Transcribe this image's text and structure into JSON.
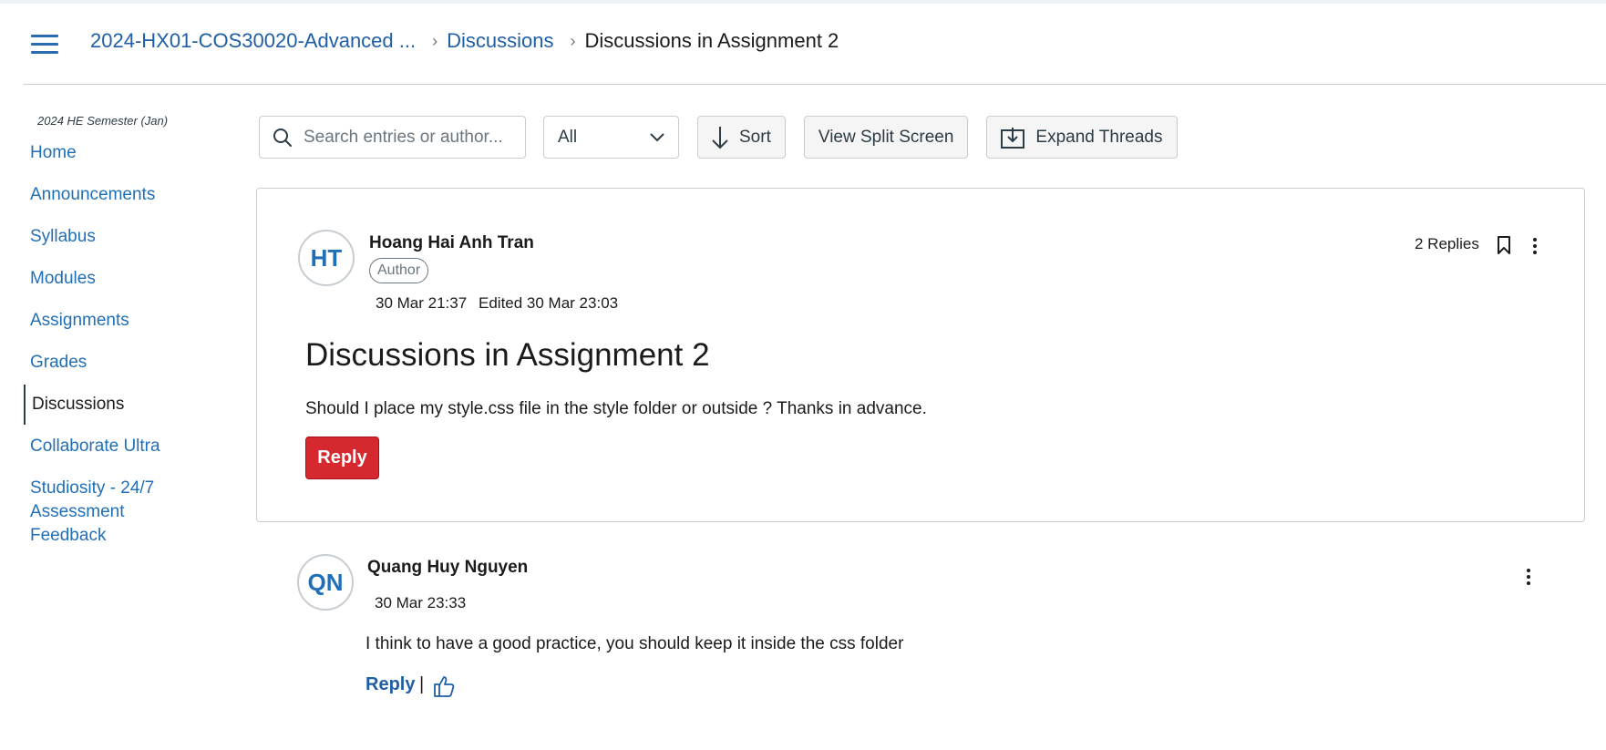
{
  "header": {
    "breadcrumb": {
      "course": "2024-HX01-COS30020-Advanced ...",
      "section": "Discussions",
      "current": "Discussions in Assignment 2"
    }
  },
  "sidebar": {
    "term": "2024 HE Semester (Jan)",
    "items": [
      {
        "label": "Home"
      },
      {
        "label": "Announcements"
      },
      {
        "label": "Syllabus"
      },
      {
        "label": "Modules"
      },
      {
        "label": "Assignments"
      },
      {
        "label": "Grades"
      },
      {
        "label": "Discussions",
        "active": true
      },
      {
        "label": "Collaborate Ultra"
      },
      {
        "label": "Studiosity - 24/7 Assessment Feedback"
      }
    ]
  },
  "toolbar": {
    "search_placeholder": "Search entries or author...",
    "filter_value": "All",
    "sort_label": "Sort",
    "split_label": "View Split Screen",
    "expand_label": "Expand Threads"
  },
  "post": {
    "initials": "HT",
    "author": "Hoang Hai Anh Tran",
    "badge": "Author",
    "time": "30 Mar 21:37",
    "edited": "Edited 30 Mar 23:03",
    "replies": "2 Replies",
    "title": "Discussions in Assignment 2",
    "body": "Should I place my style.css file in the style folder or outside ? Thanks in advance.",
    "reply_label": "Reply"
  },
  "reply_entry": {
    "initials": "QN",
    "author": "Quang Huy Nguyen",
    "time": "30 Mar 23:33",
    "body": "I think to have a good practice, you should keep it inside the css folder",
    "reply_label": "Reply",
    "divider": "|"
  },
  "colors": {
    "link": "#1f5fa6",
    "reply_button": "#d6282f",
    "avatar_text": "#1f6fb8"
  }
}
